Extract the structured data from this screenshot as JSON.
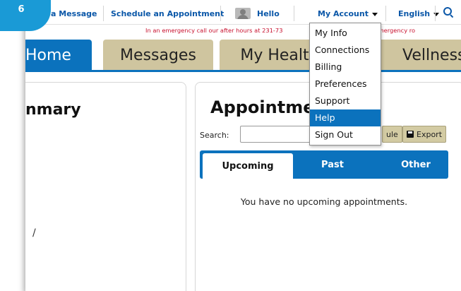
{
  "badge": {
    "number": "6"
  },
  "topbar": {
    "send_message": "a Message",
    "schedule": "Schedule an Appointment",
    "hello": "Hello",
    "my_account": "My Account",
    "language": "English",
    "search_icon": "search-icon"
  },
  "emergency_text": "In an emergency call our after hours at 231-73",
  "emergency_text_right": "o the emergency ro",
  "tabs": [
    {
      "label": "Home"
    },
    {
      "label": "Messages"
    },
    {
      "label": "My Healt"
    },
    {
      "label": "Vellness"
    }
  ],
  "summary": {
    "title": "nmary",
    "stray": "/"
  },
  "appointments": {
    "title": "Appointme",
    "search_label": "Search:",
    "search_value": "",
    "schedule_button": "ule",
    "export_button": "Export",
    "subtabs": [
      {
        "label": "Upcoming"
      },
      {
        "label": "Past"
      },
      {
        "label": "Other"
      }
    ],
    "empty_message": "You have no upcoming appointments."
  },
  "account_menu": {
    "items": [
      {
        "label": "My Info"
      },
      {
        "label": "Connections"
      },
      {
        "label": "Billing"
      },
      {
        "label": "Preferences"
      },
      {
        "label": "Support"
      },
      {
        "label": "Help"
      },
      {
        "label": "Sign Out"
      }
    ],
    "highlighted": "Help"
  },
  "colors": {
    "primary_blue": "#0b72bd",
    "tab_tan": "#cfc59f",
    "link_blue": "#0a57a8",
    "emergency_red": "#c8102e",
    "badge_blue": "#1a9ad6"
  }
}
